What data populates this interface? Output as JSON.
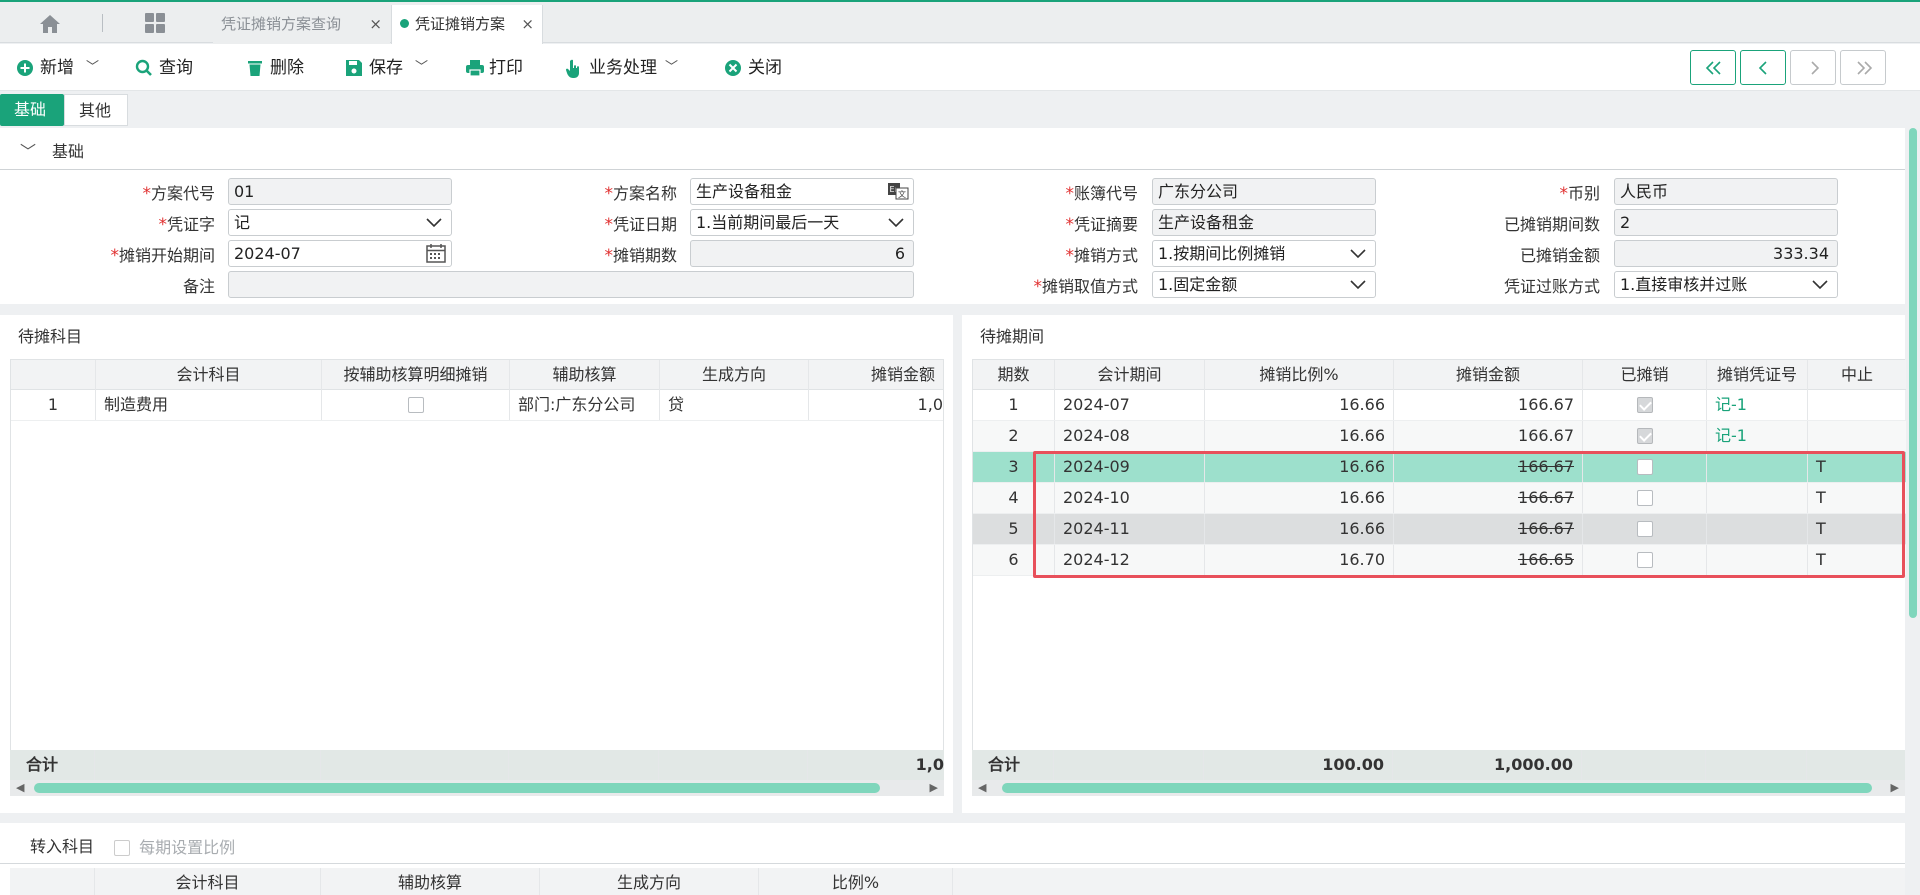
{
  "tabs": {
    "tab1_label": "凭证摊销方案查询",
    "tab2_label": "凭证摊销方案",
    "close_glyph": "×"
  },
  "toolbar": {
    "new_label": "新增",
    "query_label": "查询",
    "delete_label": "删除",
    "save_label": "保存",
    "print_label": "打印",
    "business_label": "业务处理",
    "close_label": "关闭"
  },
  "subtabs": {
    "basic": "基础",
    "other": "其他"
  },
  "form": {
    "section_title": "基础",
    "scheme_code_label": "方案代号",
    "scheme_code": "01",
    "scheme_name_label": "方案名称",
    "scheme_name": "生产设备租金",
    "book_code_label": "账簿代号",
    "book_code": "广东分公司",
    "currency_label": "币别",
    "currency": "人民币",
    "voucher_word_label": "凭证字",
    "voucher_word": "记",
    "voucher_date_label": "凭证日期",
    "voucher_date": "1.当前期间最后一天",
    "voucher_summary_label": "凭证摘要",
    "voucher_summary": "生产设备租金",
    "amortized_periods_label": "已摊销期间数",
    "amortized_periods": "2",
    "start_period_label": "摊销开始期间",
    "start_period": "2024-07",
    "periods_count_label": "摊销期数",
    "periods_count": "6",
    "method_label": "摊销方式",
    "method": "1.按期间比例摊销",
    "amortized_amount_label": "已摊销金额",
    "amortized_amount": "333.34",
    "remark_label": "备注",
    "remark": "",
    "value_method_label": "摊销取值方式",
    "value_method": "1.固定金额",
    "posting_method_label": "凭证过账方式",
    "posting_method": "1.直接审核并过账"
  },
  "left_panel": {
    "title": "待摊科目",
    "columns": [
      "会计科目",
      "按辅助核算明细摊销",
      "辅助核算",
      "生成方向",
      "摊销金额"
    ],
    "rows": [
      {
        "no": "1",
        "account": "制造费用",
        "aux": "部门:广东分公司",
        "direction": "贷",
        "amount": "1,0"
      }
    ],
    "total_label": "合计",
    "total_amount": "1,0"
  },
  "right_panel": {
    "title": "待摊期间",
    "columns": [
      "期数",
      "会计期间",
      "摊销比例%",
      "摊销金额",
      "已摊销",
      "摊销凭证号",
      "中止"
    ],
    "rows": [
      {
        "no": "1",
        "period": "2024-07",
        "ratio": "16.66",
        "amount": "166.67",
        "done": true,
        "voucher": "记-1",
        "stop": ""
      },
      {
        "no": "2",
        "period": "2024-08",
        "ratio": "16.66",
        "amount": "166.67",
        "done": true,
        "voucher": "记-1",
        "stop": ""
      },
      {
        "no": "3",
        "period": "2024-09",
        "ratio": "16.66",
        "amount": "166.67",
        "done": false,
        "voucher": "",
        "stop": "T"
      },
      {
        "no": "4",
        "period": "2024-10",
        "ratio": "16.66",
        "amount": "166.67",
        "done": false,
        "voucher": "",
        "stop": "T"
      },
      {
        "no": "5",
        "period": "2024-11",
        "ratio": "16.66",
        "amount": "166.67",
        "done": false,
        "voucher": "",
        "stop": "T"
      },
      {
        "no": "6",
        "period": "2024-12",
        "ratio": "16.70",
        "amount": "166.65",
        "done": false,
        "voucher": "",
        "stop": "T"
      }
    ],
    "total_label": "合计",
    "total_ratio": "100.00",
    "total_amount": "1,000.00"
  },
  "bottom_panel": {
    "title": "转入科目",
    "checkbox_label": "每期设置比例",
    "columns": [
      "会计科目",
      "辅助核算",
      "生成方向",
      "比例%"
    ]
  },
  "colors": {
    "accent": "#1aa37a",
    "selected_row": "#9de0cc",
    "highlight_box": "#e8505b"
  }
}
